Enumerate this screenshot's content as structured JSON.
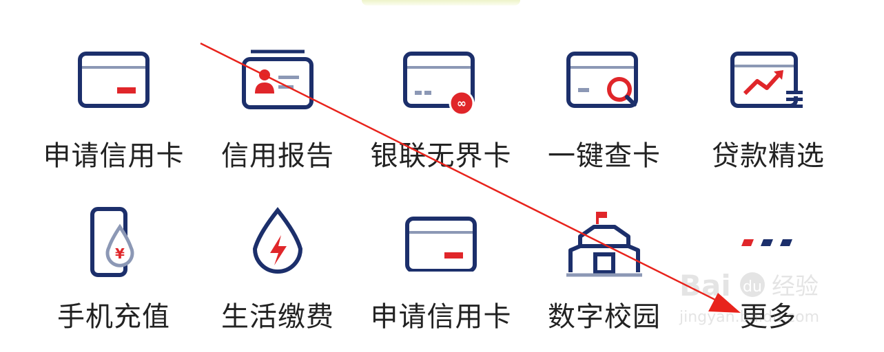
{
  "colors": {
    "navy": "#1c2f6b",
    "red": "#e0262a",
    "gray": "#8c98b5",
    "text": "#222222",
    "annotation": "#e8231c"
  },
  "grid": {
    "items": [
      {
        "label": "申请信用卡",
        "icon": "credit-card-icon"
      },
      {
        "label": "信用报告",
        "icon": "id-card-icon"
      },
      {
        "label": "银联无界卡",
        "icon": "unionpay-card-icon"
      },
      {
        "label": "一键查卡",
        "icon": "card-search-icon"
      },
      {
        "label": "贷款精选",
        "icon": "loan-chart-icon"
      },
      {
        "label": "手机充值",
        "icon": "phone-topup-icon"
      },
      {
        "label": "生活缴费",
        "icon": "utility-bolt-icon"
      },
      {
        "label": "申请信用卡",
        "icon": "credit-card-icon"
      },
      {
        "label": "数字校园",
        "icon": "campus-icon"
      },
      {
        "label": "更多",
        "icon": "more-dots-icon"
      }
    ]
  },
  "watermark": {
    "brand": "Bai",
    "brand2": "du",
    "cn": "经验",
    "url": "jingyan.baidu.com"
  }
}
